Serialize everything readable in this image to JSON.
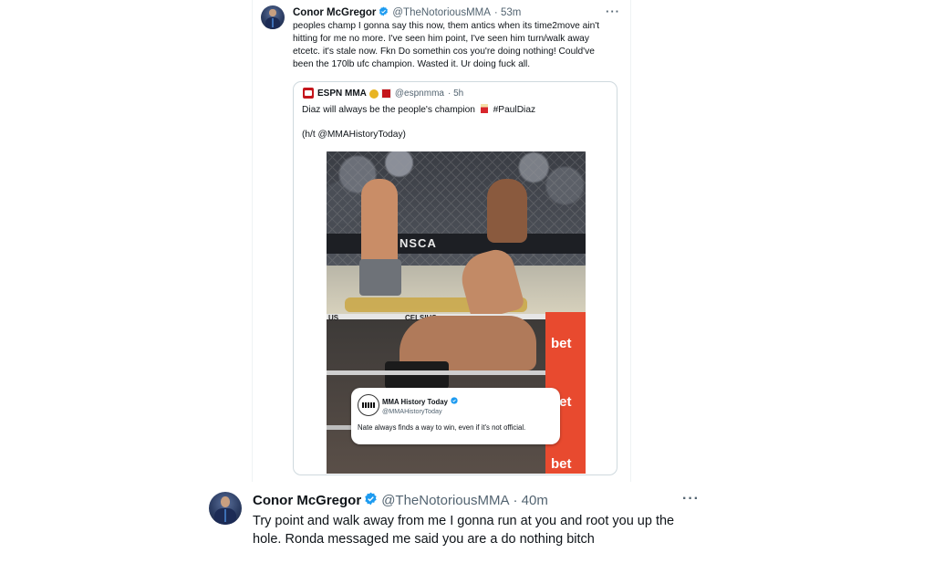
{
  "colors": {
    "verified_blue": "#1d9bf0",
    "espn_red": "#c4161c",
    "bet_orange": "#e84a2f"
  },
  "tweet1": {
    "name": "Conor McGregor",
    "handle": "@TheNotoriousMMA",
    "time": "· 53m",
    "more": "···",
    "text": "peoples champ I gonna say this now, them antics when its time2move ain't hitting for me no more. I've seen him point, I've seen him turn/walk away etcetc. it's stale now. Fkn Do somethin cos you're doing nothing! Could've been the 170lb ufc champion. Wasted it. Ur doing fuck all.",
    "quote": {
      "name": "ESPN MMA",
      "handle": "@espnmma",
      "time": "· 5h",
      "text_before": "Diaz will always be the people's champion",
      "hashtag": "#PaulDiaz",
      "credit": "(h/t @MMAHistoryToday)",
      "photo": {
        "banner_text": "NSCA",
        "rope_text_1": "US",
        "rope_text_2": "CELSIUS",
        "bet_text": "bet",
        "embed": {
          "name": "MMA History Today",
          "handle": "@MMAHistoryToday",
          "text": "Nate always finds a way to win, even if it's not official."
        }
      }
    }
  },
  "tweet2": {
    "name": "Conor McGregor",
    "handle": "@TheNotoriousMMA",
    "time": "· 40m",
    "more": "···",
    "text": "Try point and walk away from me I gonna run at you and root you up the hole. Ronda messaged me said you are a do nothing bitch"
  }
}
